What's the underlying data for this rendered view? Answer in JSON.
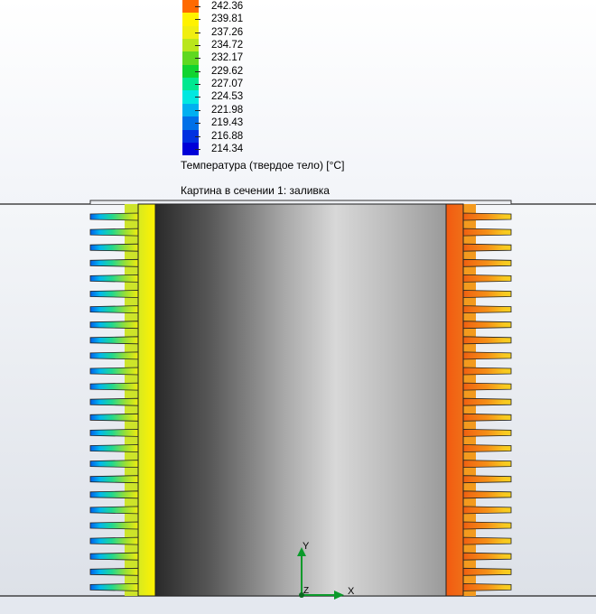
{
  "legend": {
    "values": [
      "242.36",
      "239.81",
      "237.26",
      "234.72",
      "232.17",
      "229.62",
      "227.07",
      "224.53",
      "221.98",
      "219.43",
      "216.88",
      "214.34"
    ],
    "colors": [
      "#ff6a00",
      "#fff200",
      "#f0ee10",
      "#b9e61c",
      "#5fd820",
      "#10d430",
      "#00e890",
      "#00e8e0",
      "#00b0f0",
      "#0070e8",
      "#0030e0",
      "#0000d8"
    ],
    "title": "Температура (твердое тело) [°C]"
  },
  "section": {
    "title": "Картина в сечении 1: заливка"
  },
  "triad": {
    "x_label": "X",
    "y_label": "Y",
    "z_label": "Z"
  }
}
